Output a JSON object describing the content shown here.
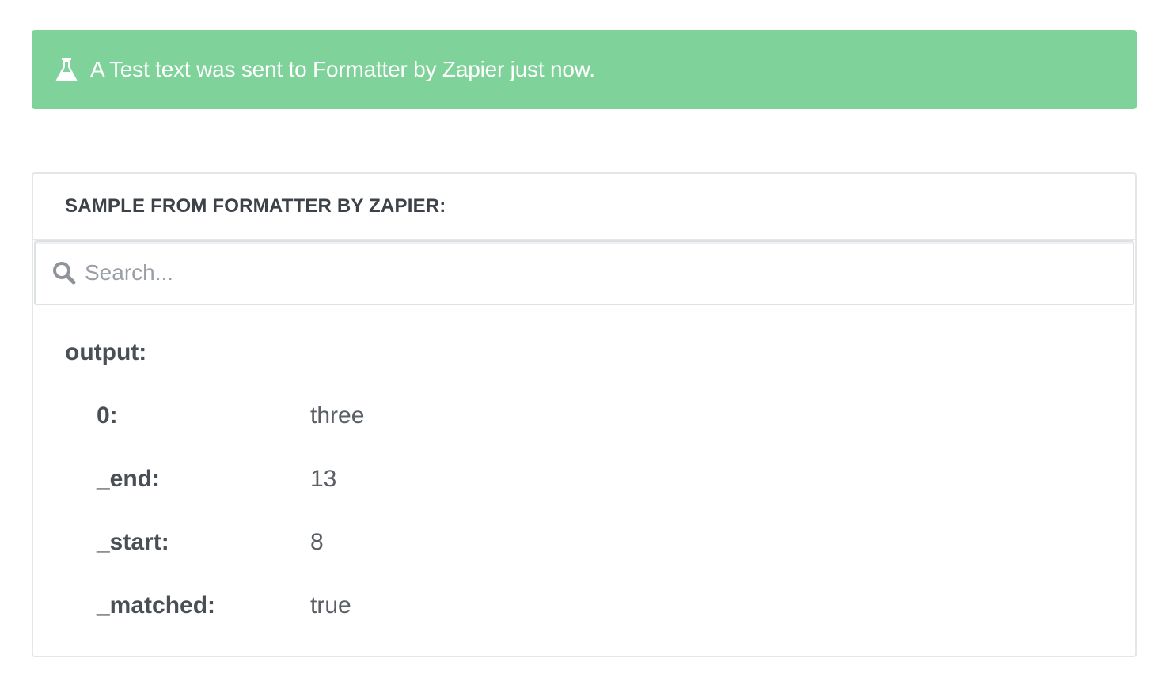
{
  "banner": {
    "icon": "flask-icon",
    "message": "A Test text was sent to Formatter by Zapier just now.",
    "color": "#7fd29a"
  },
  "panel": {
    "title": "SAMPLE FROM FORMATTER BY ZAPIER:",
    "search": {
      "icon": "search-icon",
      "placeholder": "Search..."
    },
    "section_key": "output:",
    "rows": [
      {
        "key": "0:",
        "value": "three"
      },
      {
        "key": "_end:",
        "value": "13"
      },
      {
        "key": "_start:",
        "value": "8"
      },
      {
        "key": "_matched:",
        "value": "true"
      }
    ]
  }
}
